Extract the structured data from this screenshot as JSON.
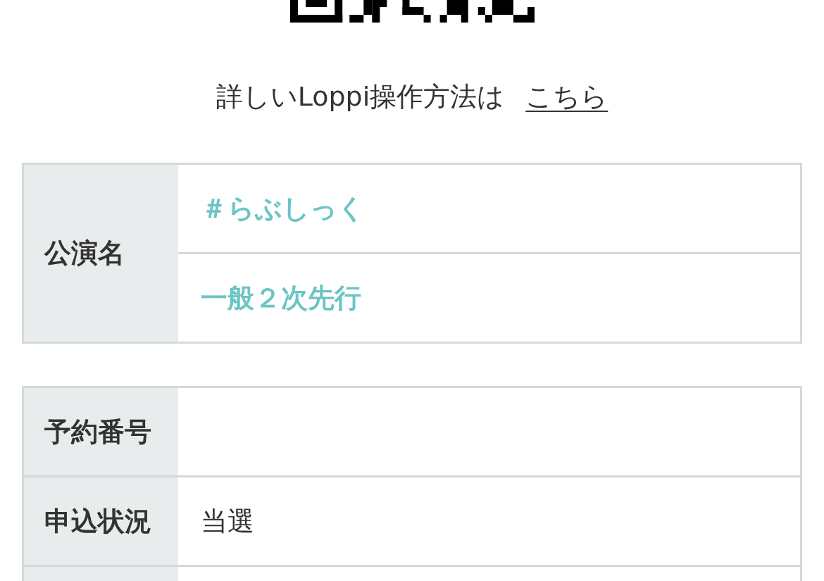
{
  "help_text": {
    "text": "詳しいLoppi操作方法は",
    "link": "こちら"
  },
  "tables": [
    {
      "kind": "grouped",
      "label": "公演名",
      "values": [
        "＃らぶしっく",
        "一般２次先行"
      ]
    },
    {
      "kind": "rows",
      "rows": [
        {
          "label": "予約番号"
        },
        {
          "label": "申込状況",
          "value": "当選"
        }
      ],
      "continues_below": true
    }
  ]
}
